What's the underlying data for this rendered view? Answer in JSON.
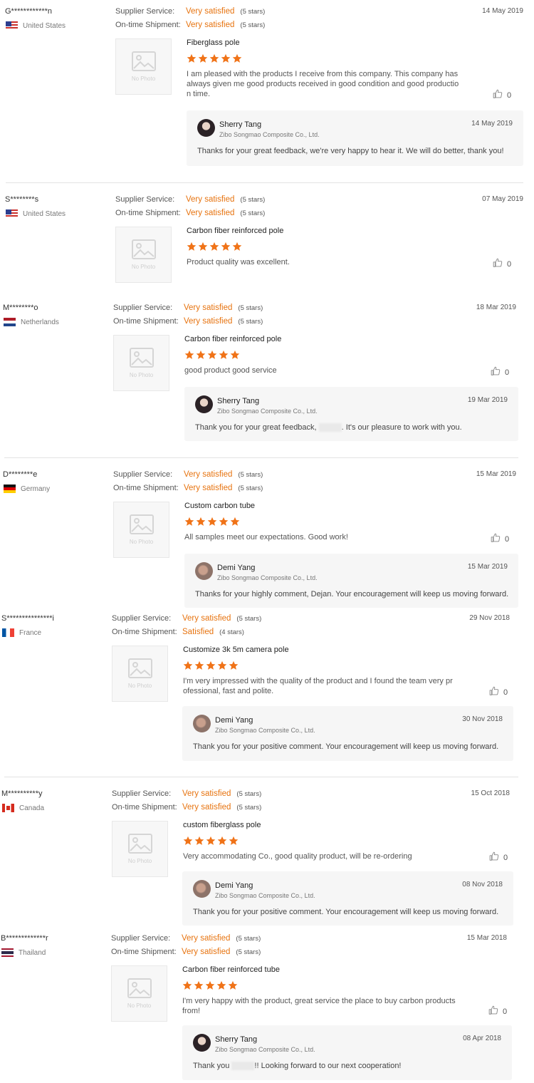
{
  "labels": {
    "supplier_service": "Supplier Service:",
    "on_time_shipment": "On-time Shipment:",
    "no_photo": "No Photo",
    "company": "Zibo Songmao Composite Co., Ltd."
  },
  "colors": {
    "accent": "#e7730f",
    "star": "#f07318",
    "reply_bg": "#f6f6f6"
  },
  "reviews": [
    {
      "name": "G************n",
      "country": "United States",
      "flag_icon": "us-flag-icon",
      "supplier_value": "Very satisfied",
      "supplier_stars": "(5 stars)",
      "shipment_value": "Very satisfied",
      "shipment_stars": "(5 stars)",
      "date": "14 May 2019",
      "product": "Fiberglass pole",
      "rating": 5,
      "comment_lines": [
        "I am pleased with the products I receive from this company. This company has",
        "always given me good products received in good condition and good productio",
        "n time."
      ],
      "likes": "0",
      "reply": {
        "name": "Sherry Tang",
        "date": "14 May 2019",
        "text": "Thanks for your great feedback, we're very happy to hear it. We will do better, thank you!"
      }
    },
    {
      "name": "S********s",
      "country": "United States",
      "flag_icon": "us-flag-icon",
      "supplier_value": "Very satisfied",
      "supplier_stars": "(5 stars)",
      "shipment_value": "Very satisfied",
      "shipment_stars": "(5 stars)",
      "date": "07 May 2019",
      "product": "Carbon fiber reinforced pole",
      "rating": 5,
      "comment_lines": [
        "Product quality was excellent."
      ],
      "likes": "0"
    },
    {
      "name": "M********o",
      "country": "Netherlands",
      "flag_icon": "netherlands-flag-icon",
      "supplier_value": "Very satisfied",
      "supplier_stars": "(5 stars)",
      "shipment_value": "Very satisfied",
      "shipment_stars": "(5 stars)",
      "date": "18 Mar 2019",
      "product": "Carbon fiber reinforced pole",
      "rating": 5,
      "comment_lines": [
        "good product good service"
      ],
      "likes": "0",
      "reply": {
        "name": "Sherry Tang",
        "date": "19 Mar 2019",
        "text_before": "Thank you for your great feedback, ",
        "text_after": ". It's our pleasure to work with you."
      }
    },
    {
      "name": "D********e",
      "country": "Germany",
      "flag_icon": "germany-flag-icon",
      "supplier_value": "Very satisfied",
      "supplier_stars": "(5 stars)",
      "shipment_value": "Very satisfied",
      "shipment_stars": "(5 stars)",
      "date": "15 Mar 2019",
      "product": "Custom carbon tube",
      "rating": 5,
      "comment_lines": [
        "All samples meet our expectations. Good work!"
      ],
      "likes": "0",
      "reply": {
        "name": "Demi Yang",
        "date": "15 Mar 2019",
        "text": "Thanks for your highly comment, Dejan. Your encouragement will keep us moving forward."
      }
    },
    {
      "name": "S***************i",
      "country": "France",
      "flag_icon": "france-flag-icon",
      "supplier_value": "Very satisfied",
      "supplier_stars": "(5 stars)",
      "shipment_value": "Satisfied",
      "shipment_stars": "(4 stars)",
      "date": "29 Nov 2018",
      "product": "Customize 3k 5m camera pole",
      "rating": 5,
      "comment_lines": [
        "I'm very impressed with the quality of the product and I found the team very pr",
        "ofessional, fast and polite."
      ],
      "likes": "0",
      "reply": {
        "name": "Demi Yang",
        "date": "30 Nov 2018",
        "text": "Thank you for your positive comment. Your encouragement will keep us moving forward."
      }
    },
    {
      "name": "M**********y",
      "country": "Canada",
      "flag_icon": "canada-flag-icon",
      "supplier_value": "Very satisfied",
      "supplier_stars": "(5 stars)",
      "shipment_value": "Very satisfied",
      "shipment_stars": "(5 stars)",
      "date": "15 Oct 2018",
      "product": "custom fiberglass pole",
      "rating": 5,
      "comment_lines": [
        "Very accommodating Co., good quality product, will be re-ordering"
      ],
      "likes": "0",
      "reply": {
        "name": "Demi Yang",
        "date": "08 Nov 2018",
        "text": "Thank you for your positive comment. Your encouragement will keep us moving forward."
      }
    },
    {
      "name": "B*************r",
      "country": "Thailand",
      "flag_icon": "thailand-flag-icon",
      "supplier_value": "Very satisfied",
      "supplier_stars": "(5 stars)",
      "shipment_value": "Very satisfied",
      "shipment_stars": "(5 stars)",
      "date": "15 Mar 2018",
      "product": "Carbon fiber reinforced tube",
      "rating": 5,
      "comment_lines": [
        "I'm very happy with the product, great service the place to buy carbon products",
        "from!"
      ],
      "likes": "0",
      "reply": {
        "name": "Sherry Tang",
        "date": "08 Apr 2018",
        "text_before": "Thank you ",
        "text_after": "!! Looking forward to our next cooperation!"
      }
    }
  ]
}
